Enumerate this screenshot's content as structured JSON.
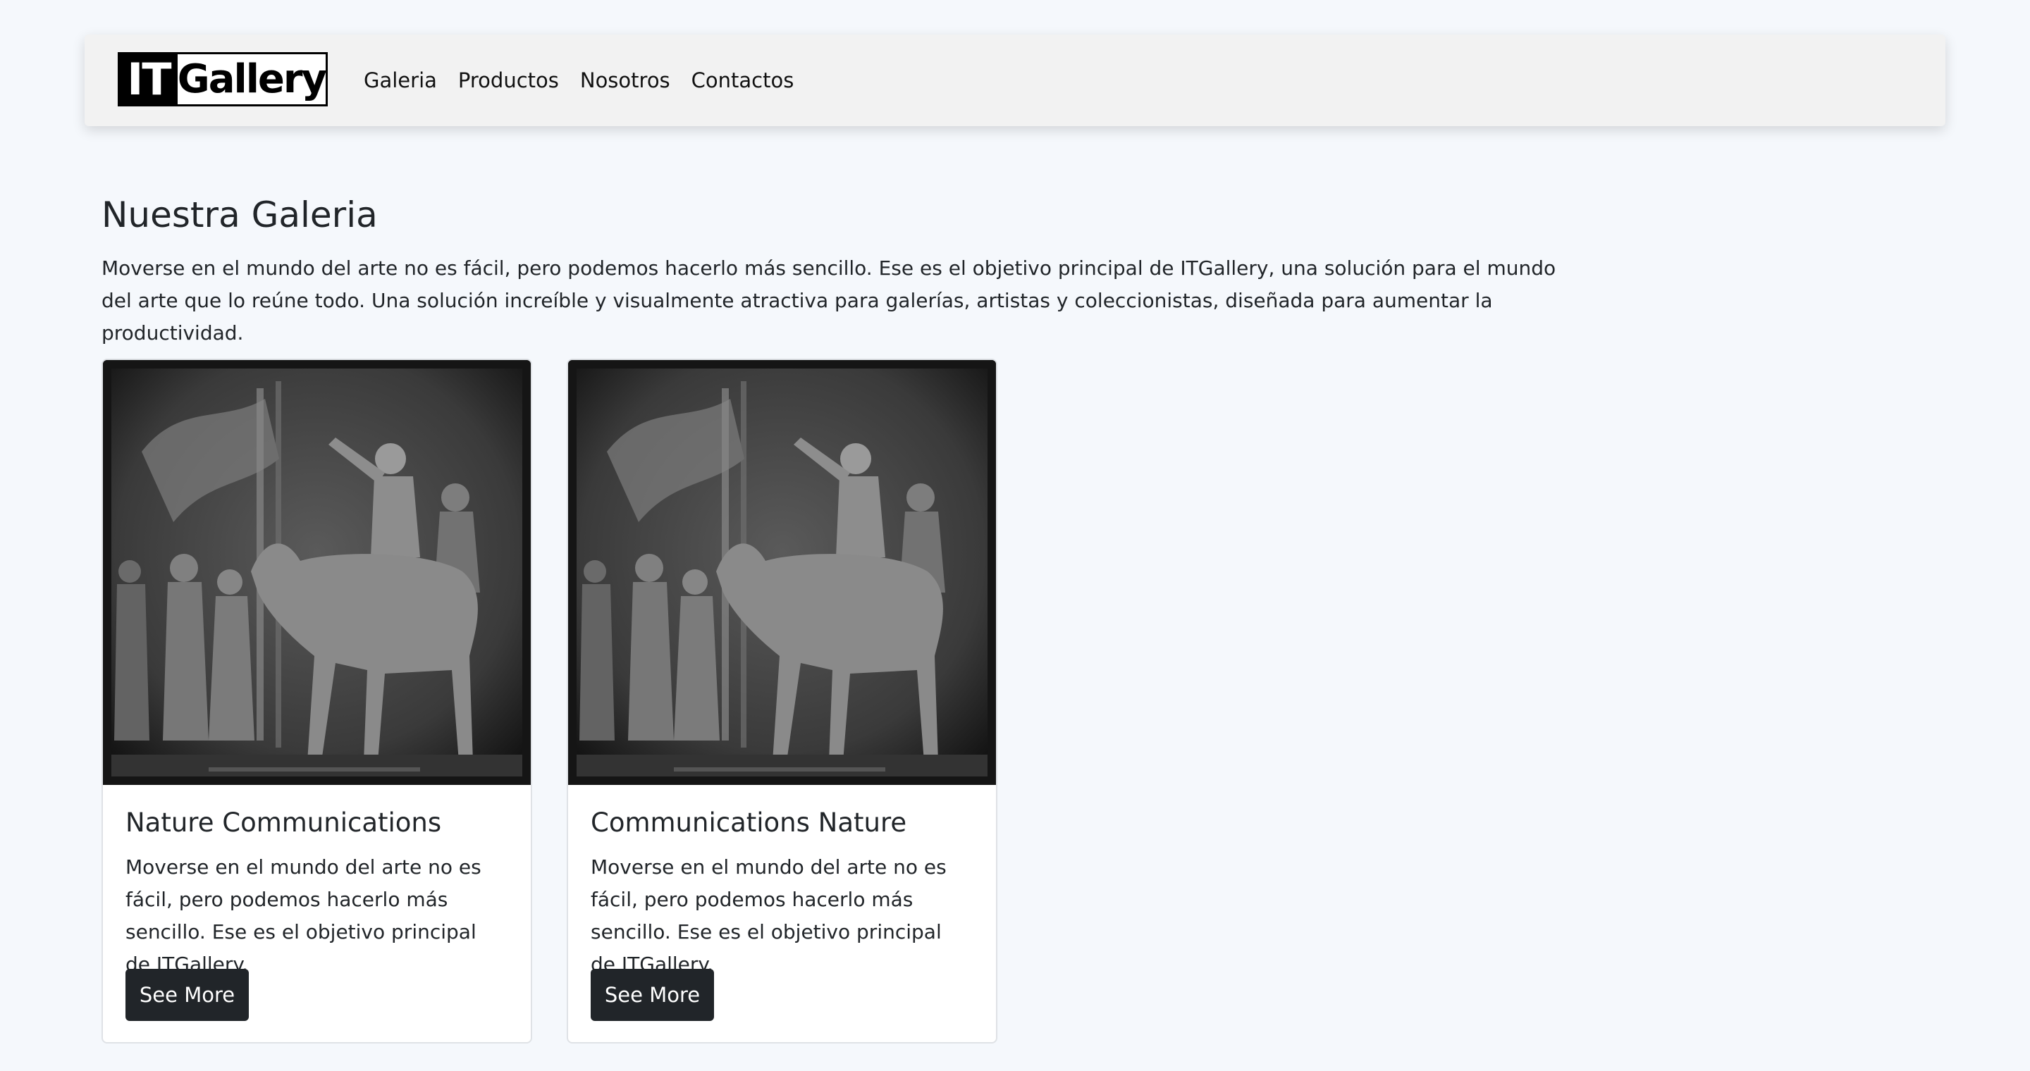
{
  "brand": {
    "part1": "IT",
    "part2": "Gallery"
  },
  "nav": {
    "items": [
      "Galeria",
      "Productos",
      "Nosotros",
      "Contactos"
    ]
  },
  "main": {
    "title": "Nuestra Galeria",
    "intro": "Moverse en el mundo del arte no es fácil, pero podemos hacerlo más sencillo. Ese es el objetivo principal de ITGallery, una solución para el mundo del arte que lo reúne todo. Una solución increíble y visualmente atractiva para galerías, artistas y coleccionistas, diseñada para aumentar la productividad."
  },
  "cards": [
    {
      "title": "Nature Communications",
      "text": "Moverse en el mundo del arte no es fácil, pero podemos hacerlo más sencillo. Ese es el objetivo principal de ITGallery.",
      "button": "See More"
    },
    {
      "title": "Communications Nature",
      "text": "Moverse en el mundo del arte no es fácil, pero podemos hacerlo más sencillo. Ese es el objetivo principal de ITGallery.",
      "button": "See More"
    }
  ],
  "colors": {
    "background": "#f5f8fc",
    "navbar": "#f2f2f2",
    "button": "#212529"
  }
}
